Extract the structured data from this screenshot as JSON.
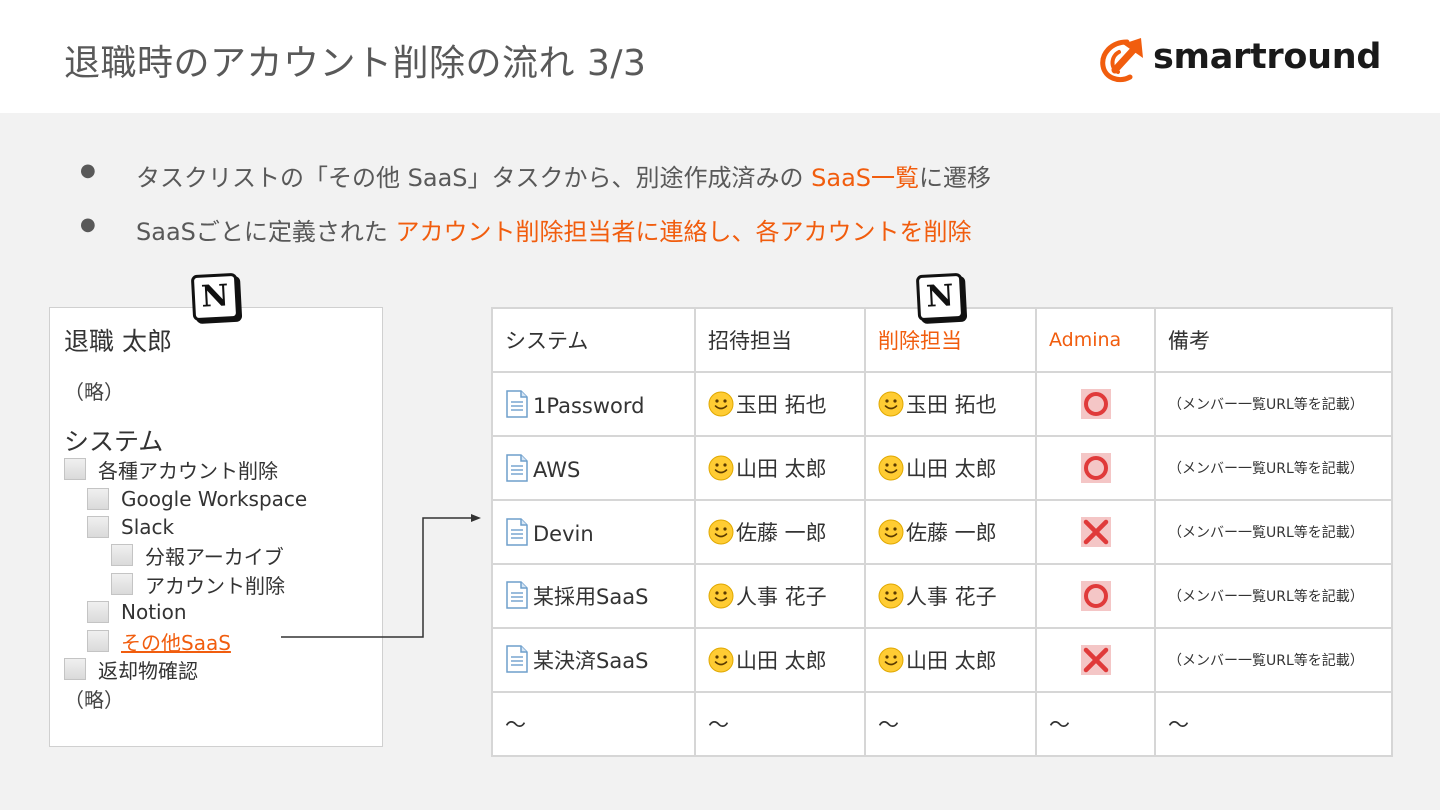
{
  "title": "退職時のアカウント削除の流れ 3/3",
  "logo": {
    "text": "smartround"
  },
  "colors": {
    "accent": "#f15d0e",
    "title": "#595959",
    "background": "#f2f2f2"
  },
  "bullets": [
    {
      "parts": [
        {
          "text": "タスクリストの「その他 SaaS」タスクから、別途作成済みの ",
          "highlight": false
        },
        {
          "text": "SaaS一覧",
          "highlight": true
        },
        {
          "text": "に遷移",
          "highlight": false
        }
      ]
    },
    {
      "parts": [
        {
          "text": "SaaSごとに定義された ",
          "highlight": false
        },
        {
          "text": "アカウント削除担当者に連絡し、各アカウントを削除",
          "highlight": true
        }
      ]
    }
  ],
  "notion_icon": {
    "glyph": "N",
    "icon": "notion-icon"
  },
  "page": {
    "title": "退職 太郎",
    "omitted_top": "（略）",
    "section": "システム",
    "items": [
      {
        "label": "各種アカウント削除",
        "level": 0,
        "link": false
      },
      {
        "label": "Google Workspace",
        "level": 1,
        "link": false
      },
      {
        "label": "Slack",
        "level": 1,
        "link": false
      },
      {
        "label": "分報アーカイブ",
        "level": 2,
        "link": false
      },
      {
        "label": "アカウント削除",
        "level": 2,
        "link": false
      },
      {
        "label": "Notion",
        "level": 1,
        "link": false
      },
      {
        "label": "その他SaaS",
        "level": 1,
        "link": true
      },
      {
        "label": "返却物確認",
        "level": 0,
        "link": false
      }
    ],
    "omitted_bottom": "（略）"
  },
  "table": {
    "headers": [
      "システム",
      "招待担当",
      "削除担当",
      "Admina",
      "備考"
    ],
    "rows": [
      {
        "system": "1Password",
        "inviter": "玉田 拓也",
        "deleter": "玉田 拓也",
        "admina": "circle",
        "note": "（メンバー一覧URL等を記載）"
      },
      {
        "system": "AWS",
        "inviter": "山田 太郎",
        "deleter": "山田 太郎",
        "admina": "circle",
        "note": "（メンバー一覧URL等を記載）"
      },
      {
        "system": "Devin",
        "inviter": "佐藤 一郎",
        "deleter": "佐藤 一郎",
        "admina": "cross",
        "note": "（メンバー一覧URL等を記載）"
      },
      {
        "system": "某採用SaaS",
        "inviter": "人事 花子",
        "deleter": "人事 花子",
        "admina": "circle",
        "note": "（メンバー一覧URL等を記載）"
      },
      {
        "system": "某決済SaaS",
        "inviter": "山田 太郎",
        "deleter": "山田 太郎",
        "admina": "cross",
        "note": "（メンバー一覧URL等を記載）"
      }
    ],
    "last_row": [
      "〜",
      "〜",
      "〜",
      "〜",
      "〜"
    ]
  }
}
